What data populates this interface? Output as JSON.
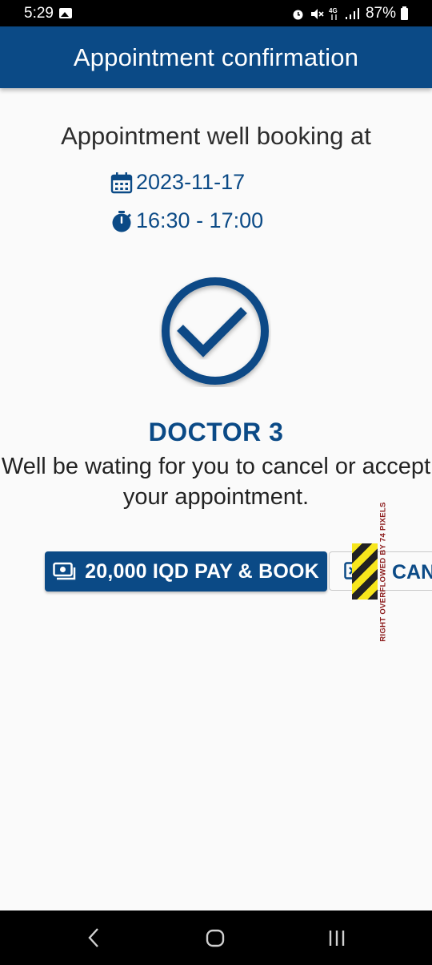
{
  "status_bar": {
    "time": "5:29",
    "battery": "87%",
    "network": "4G",
    "icons": [
      "gallery-icon",
      "alarm-icon",
      "mute-icon",
      "network-4g-icon",
      "signal-icon",
      "battery-icon"
    ]
  },
  "app_bar": {
    "title": "Appointment confirmation",
    "background": "#0b4a86"
  },
  "booking": {
    "heading": "Appointment well booking at",
    "date": "2023-11-17",
    "time": "16:30 - 17:00",
    "icons": [
      "calendar-icon",
      "stopwatch-icon",
      "check-circle-icon"
    ]
  },
  "doctor": {
    "name": "DOCTOR 3",
    "message": "Well be wating for you to cancel or accept your appointment."
  },
  "actions": {
    "pay_label": "20,000 IQD PAY & BOOK",
    "pay_icon": "money-icon",
    "cancel_label": "CANC",
    "cancel_icon": "cancel-box-icon"
  },
  "overflow_warning": {
    "text": "RIGHT OVERFLOWED BY 74 PIXELS"
  },
  "nav_bar": {
    "buttons": [
      "back",
      "home",
      "recents"
    ]
  },
  "colors": {
    "primary": "#0b4a86",
    "background": "#fafafa",
    "text": "#222222"
  }
}
